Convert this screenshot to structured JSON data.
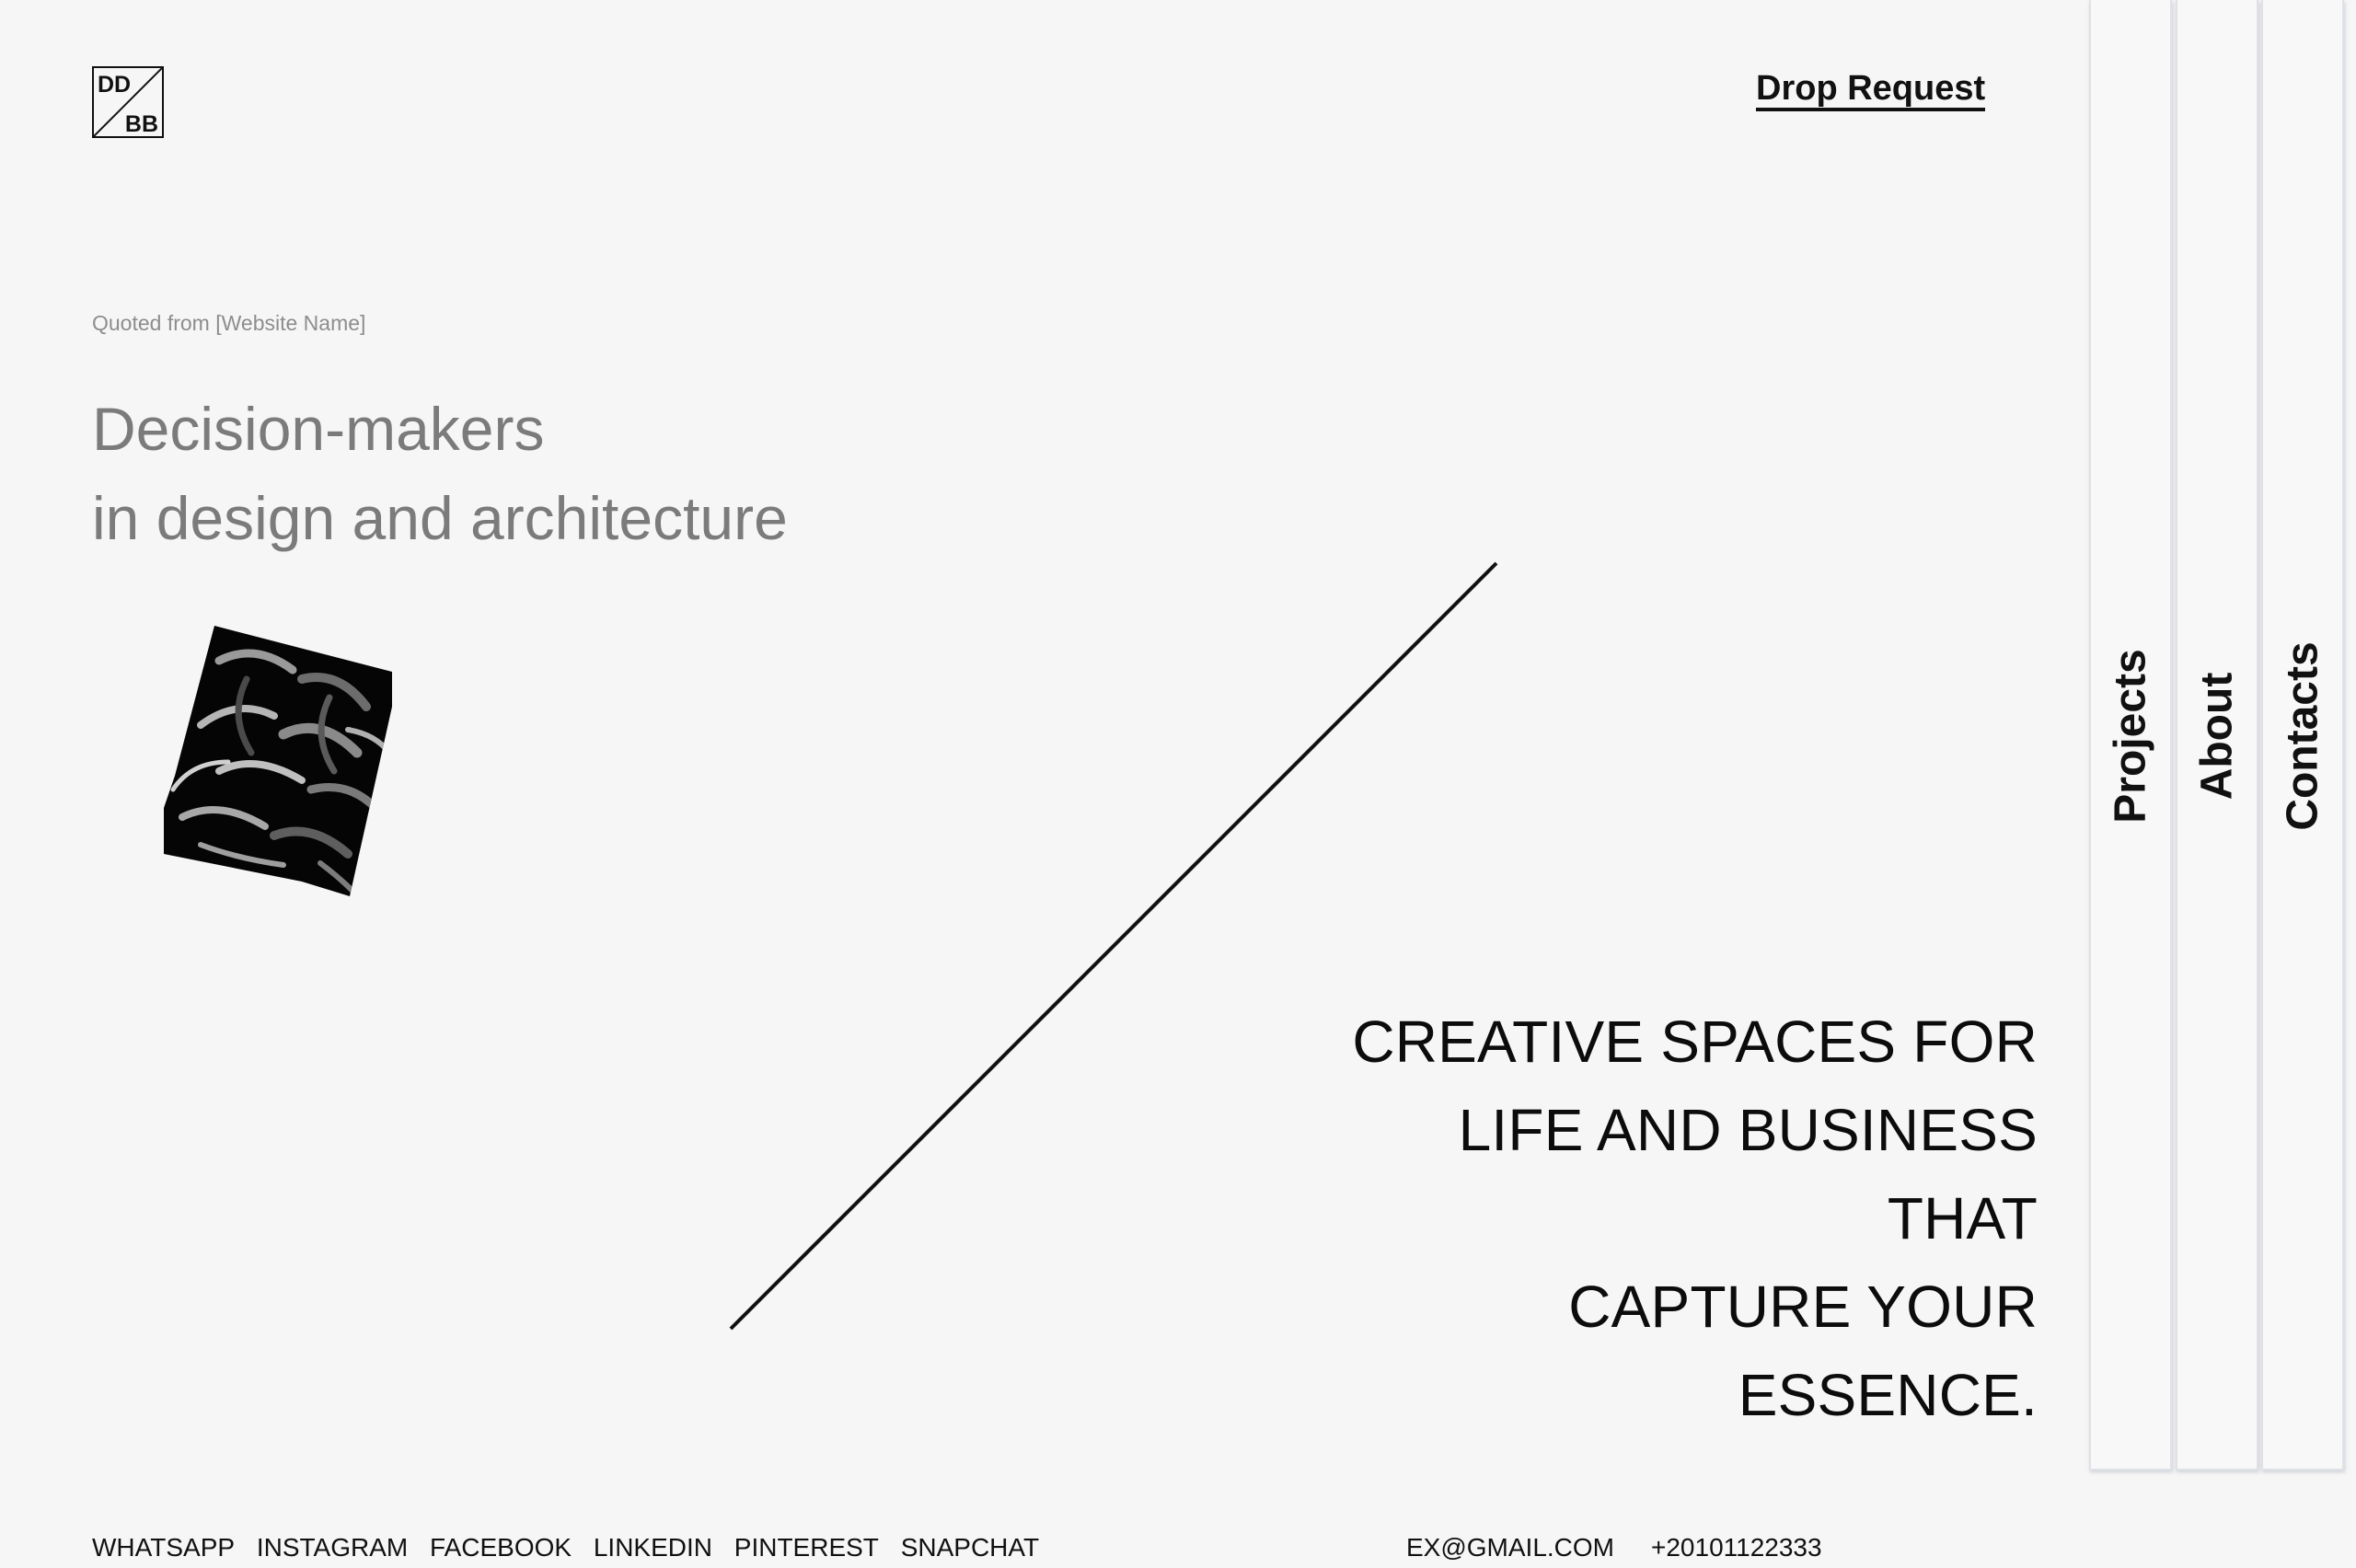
{
  "logo": {
    "line1": "DD",
    "line2": "BB"
  },
  "header": {
    "drop_request_label": "Drop Request"
  },
  "hero": {
    "quote_source": "Quoted from [Website Name]",
    "heading_lines": [
      "Decision-makers",
      "in design and architecture"
    ]
  },
  "tagline": {
    "lines": [
      "CREATIVE SPACES FOR",
      "LIFE AND BUSINESS",
      "THAT",
      "CAPTURE YOUR",
      "ESSENCE."
    ]
  },
  "side_nav": {
    "tabs": [
      {
        "label": "Projects"
      },
      {
        "label": "About"
      },
      {
        "label": "Contacts"
      }
    ]
  },
  "footer": {
    "socials": [
      "WHATSAPP",
      "INSTAGRAM",
      "FACEBOOK",
      "LINKEDIN",
      "PINTEREST",
      "SNAPCHAT"
    ],
    "email": "EX@GMAIL.COM",
    "phone": "+20101122333"
  },
  "colors": {
    "background": "#f6f6f6",
    "text": "#111111",
    "muted_heading": "#7b7b7b",
    "muted_caption": "#8d8d8d",
    "tab_border": "#dfe1e5"
  }
}
